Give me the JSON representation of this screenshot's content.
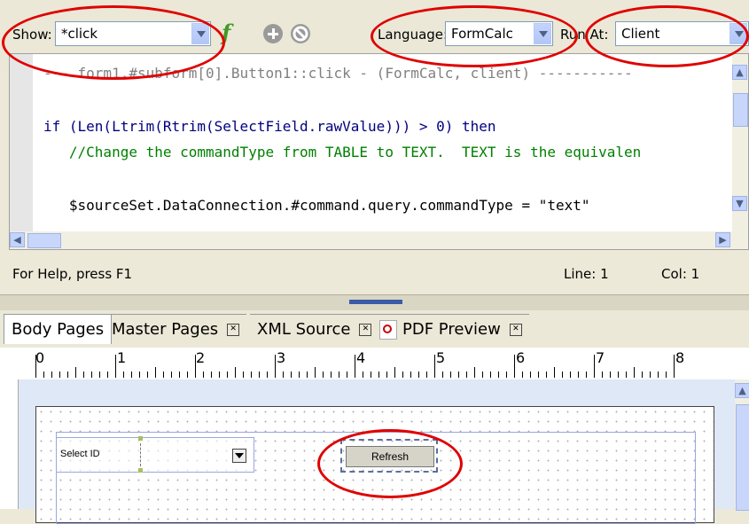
{
  "toolbar": {
    "show_label": "Show:",
    "show_value": "*click",
    "language_label": "Language:",
    "language_value": "FormCalc",
    "run_at_label": "Run At:",
    "run_at_value": "Client"
  },
  "editor": {
    "lines": [
      "--- form1.#subform[0].Button1::click - (FormCalc, client) -----------",
      "",
      "if (Len(Ltrim(Rtrim(SelectField.rawValue))) > 0) then",
      "   //Change the commandType from TABLE to TEXT.  TEXT is the equivalen",
      "",
      "   $sourceSet.DataConnection.#command.query.commandType = \"text\""
    ]
  },
  "status": {
    "help": "For Help, press F1",
    "line": "Line: 1",
    "col": "Col: 1"
  },
  "tabs": [
    {
      "label": "Body Pages"
    },
    {
      "label": "Master Pages"
    },
    {
      "label": "XML Source"
    },
    {
      "label": "PDF Preview"
    }
  ],
  "ruler": {
    "numbers": [
      "0",
      "1",
      "2",
      "3",
      "4",
      "5",
      "6",
      "7",
      "8"
    ]
  },
  "form": {
    "select_label": "Select ID",
    "refresh_label": "Refresh"
  },
  "colors": {
    "highlight_ring": "#e00000",
    "code_keyword": "#000080",
    "code_comment": "#008000"
  }
}
